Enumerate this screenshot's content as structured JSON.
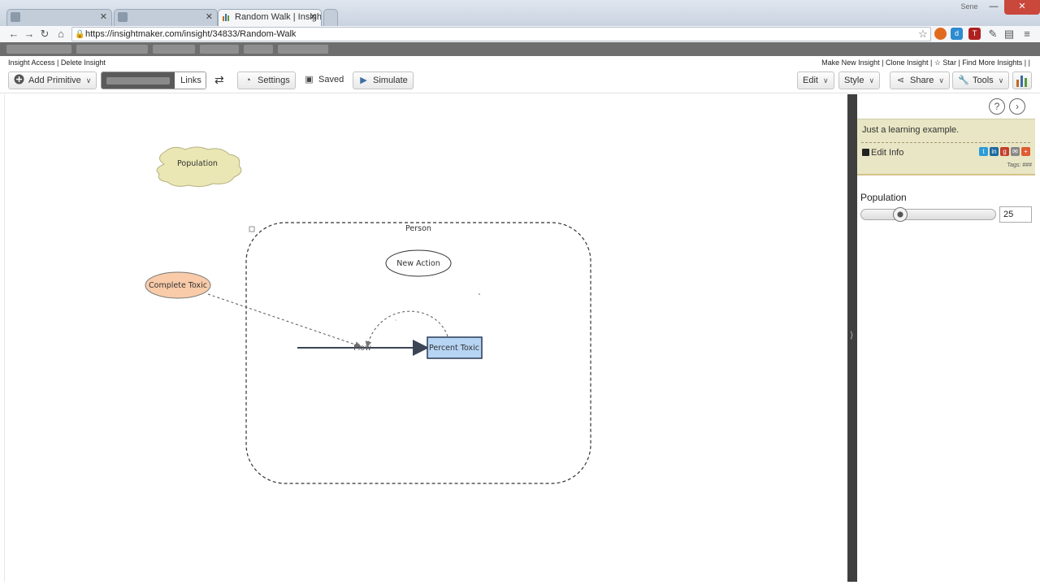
{
  "browser": {
    "tabs": [
      {
        "title": ""
      },
      {
        "title": ""
      },
      {
        "title": "Random Walk | Insight Mak"
      }
    ],
    "url": "https://insightmaker.com/insight/34833/Random-Walk",
    "window_user": "Sene"
  },
  "app_header": {
    "left_links": "Insight Access | Delete Insight",
    "right_links": "Make New Insight | Clone Insight | ☆ Star | Find More Insights | |"
  },
  "toolbar": {
    "add_primitive": "Add Primitive",
    "links": "Links",
    "settings": "Settings",
    "saved": "Saved",
    "simulate": "Simulate",
    "edit": "Edit",
    "style": "Style",
    "share": "Share",
    "tools": "Tools"
  },
  "canvas": {
    "population_label": "Population",
    "agent_container_label": "Person",
    "action_label": "New Action",
    "complete_toxic_label": "Complete Toxic",
    "flow_label": "Flow",
    "stock_label": "Percent Toxic"
  },
  "panel": {
    "description": "Just a learning example.",
    "edit_info": "Edit Info",
    "tags": "Tags: ###",
    "slider": {
      "label": "Population",
      "value": "25",
      "min": 0,
      "max": 100,
      "current": 25
    }
  },
  "colors": {
    "population_fill": "#eae7b4",
    "complete_toxic_fill": "#f9cba9",
    "stock_fill": "#b6d4f3",
    "splitter": "#3f3f3f",
    "info_box": "#e8e6c4"
  },
  "icons": {
    "add_primitive": "plus-circle-icon",
    "settings": "clock-icon",
    "saved": "floppy-icon",
    "simulate": "play-icon",
    "share": "share-icon",
    "tools": "wrench-icon"
  }
}
